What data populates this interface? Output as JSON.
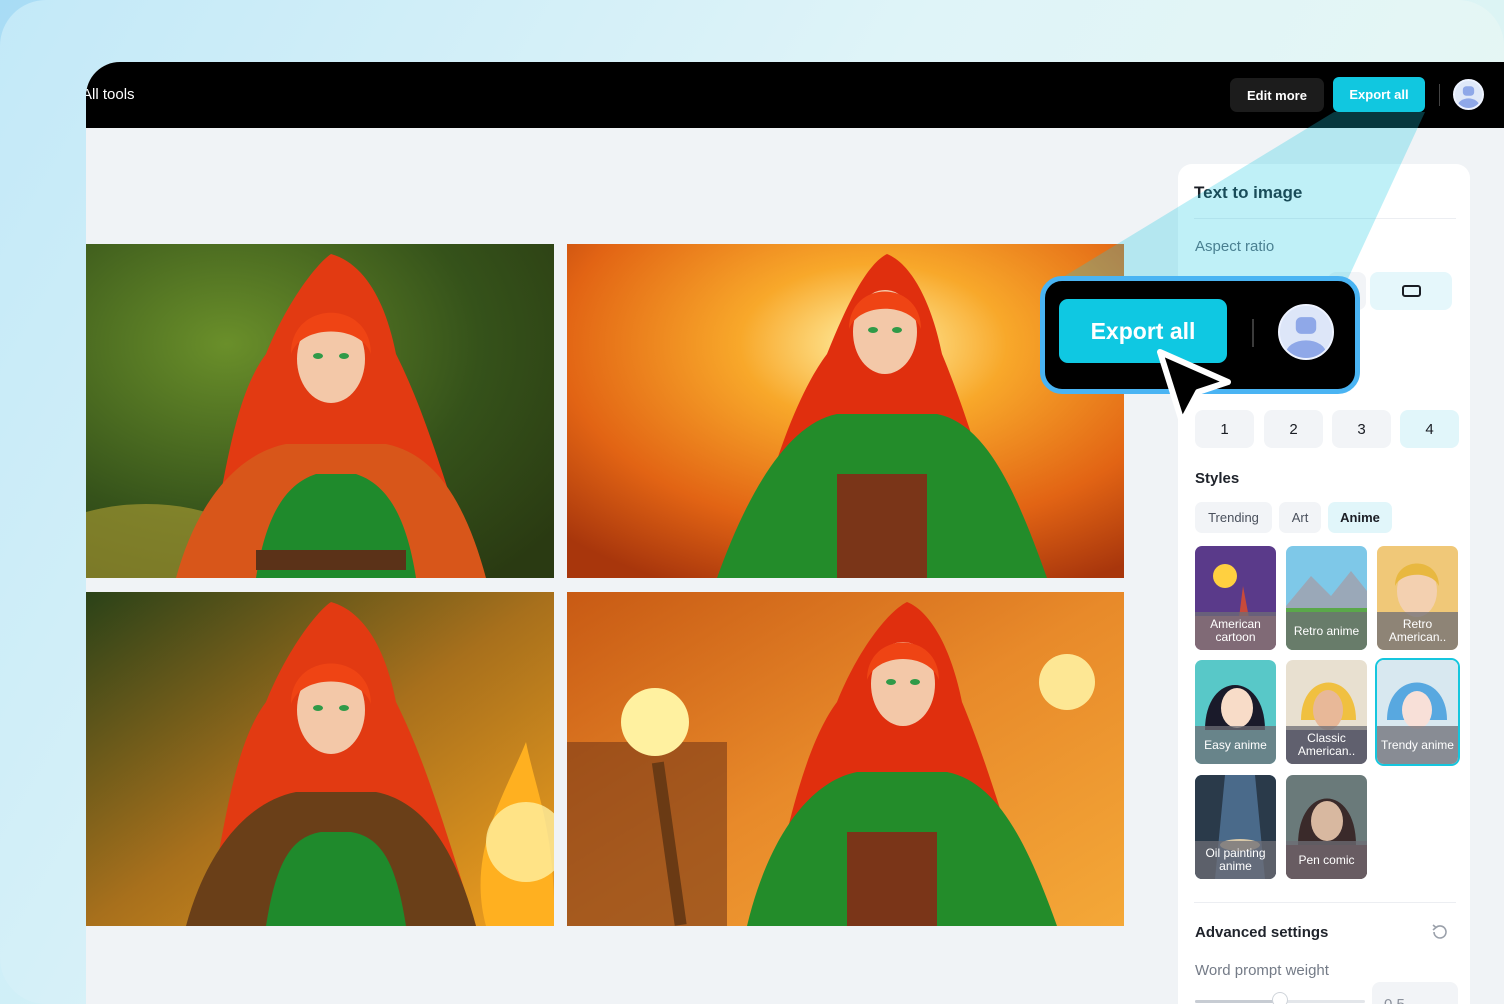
{
  "topbar": {
    "all_tools": "All tools",
    "edit_more": "Edit more",
    "export_all": "Export all"
  },
  "panel": {
    "title": "Text to image",
    "aspect_ratio_label": "Aspect ratio",
    "count_options": [
      "1",
      "2",
      "3",
      "4"
    ],
    "count_selected": "4",
    "styles_label": "Styles",
    "style_tabs": [
      "Trending",
      "Art",
      "Anime"
    ],
    "style_tab_active": "Anime",
    "styles": [
      {
        "label": "American cartoon",
        "selected": false
      },
      {
        "label": "Retro anime",
        "selected": false
      },
      {
        "label": "Retro American..",
        "selected": false
      },
      {
        "label": "Easy anime",
        "selected": false
      },
      {
        "label": "Classic American..",
        "selected": false
      },
      {
        "label": "Trendy anime",
        "selected": true
      },
      {
        "label": "Oil painting anime",
        "selected": false
      },
      {
        "label": "Pen comic",
        "selected": false
      }
    ],
    "advanced_label": "Advanced settings",
    "word_weight_label": "Word prompt weight",
    "word_weight_value": "0.5"
  },
  "callout": {
    "export_all": "Export all"
  },
  "colors": {
    "accent": "#11c7e0",
    "callout_border": "#4ab4f3",
    "topbar_bg": "#000000"
  },
  "icons": [
    "user-avatar-icon",
    "aspect-ratio-icon",
    "reset-icon",
    "mouse-pointer-icon"
  ]
}
